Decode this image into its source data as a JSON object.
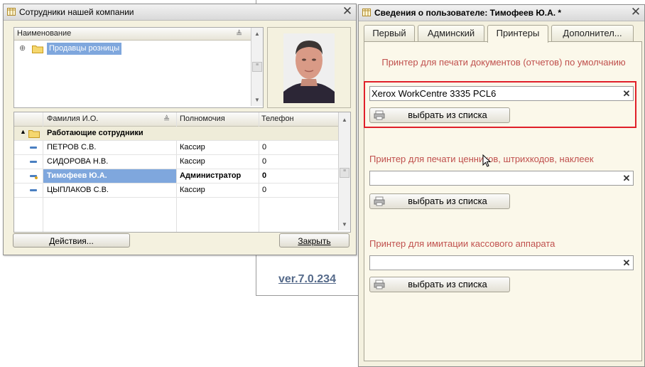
{
  "version_text": "ver.7.0.234",
  "left_window": {
    "title": "Сотрудники  нашей компании",
    "tree": {
      "header": "Наименование",
      "item": "Продавцы розницы"
    },
    "table": {
      "headers": [
        "Фамилия И.О.",
        "Полномочия",
        "Телефон"
      ],
      "group_label": "Работающие сотрудники",
      "rows": [
        {
          "name": "ПЕТРОВ С.В.",
          "role": "Кассир",
          "phone": "0"
        },
        {
          "name": "СИДОРОВА Н.В.",
          "role": "Кассир",
          "phone": "0"
        },
        {
          "name": "Тимофеев Ю.А.",
          "role": "Администратор",
          "phone": "0"
        },
        {
          "name": "ЦЫПЛАКОВ С.В.",
          "role": "Кассир",
          "phone": "0"
        }
      ]
    },
    "actions_label": "Действия...",
    "close_label": "Закрыть"
  },
  "right_window": {
    "title": "Сведения о пользователе: Тимофеев Ю.А. *",
    "tabs": [
      "Первый",
      "Админский",
      "Принтеры",
      "Дополнител..."
    ],
    "active_tab_index": 2,
    "printers": [
      {
        "label": "Принтер для печати документов (отчетов) по умолчанию",
        "value": "Xerox WorkCentre 3335 PCL6",
        "button": "выбрать из списка"
      },
      {
        "label": "Принтер для печати ценников, штрихкодов, наклеек",
        "value": "",
        "button": "выбрать из списка"
      },
      {
        "label": "Принтер для имитации кассового аппарата",
        "value": "",
        "button": "выбрать из списка"
      }
    ]
  },
  "colors": {
    "window_bg": "#f4f1df",
    "label_red": "#c0504d",
    "selection": "#7fa7dd",
    "highlight_border": "#e0202a",
    "group_row": "#efecd9"
  }
}
